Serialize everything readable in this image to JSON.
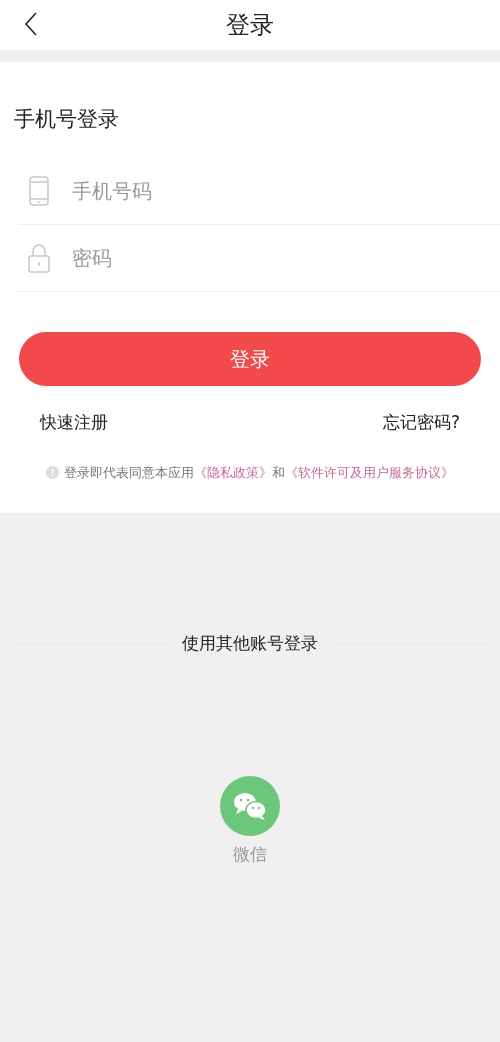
{
  "header": {
    "title": "登录"
  },
  "form": {
    "heading": "手机号登录",
    "fields": [
      {
        "kind": "phone",
        "placeholder": "手机号码"
      },
      {
        "kind": "password",
        "placeholder": "密码"
      }
    ],
    "submit": "登录",
    "register_link": "快速注册",
    "forgot_link": "忘记密码?",
    "legal": {
      "text_before": "登录即代表同意本应用",
      "privacy_link": "《隐私政策》",
      "joiner": "和",
      "terms_link": "《软件许可及用户服务协议》"
    }
  },
  "other_login": {
    "heading": "使用其他账号登录",
    "options": [
      {
        "kind": "wechat",
        "label": "微信"
      }
    ]
  }
}
